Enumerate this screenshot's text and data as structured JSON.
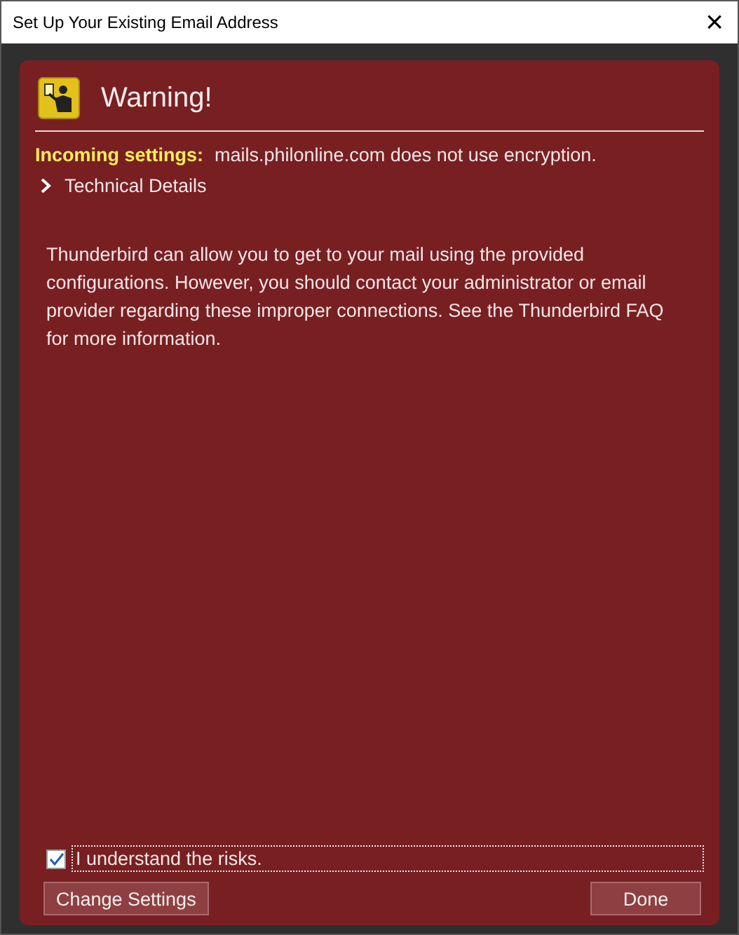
{
  "window": {
    "title": "Set Up Your Existing Email Address",
    "close": "×"
  },
  "warning": {
    "title": "Warning!",
    "settings": [
      {
        "label": "Incoming settings:",
        "message": "mails.philonline.com does not use encryption."
      }
    ],
    "details": {
      "label": "Technical Details",
      "expanded": false
    },
    "body": "Thunderbird can allow you to get to your mail using the provided configurations. However, you should contact your administrator or email provider regarding these improper connections. See the Thunderbird FAQ for more information.",
    "acknowledge": {
      "label": "I understand the risks.",
      "checked": true
    }
  },
  "buttons": [
    {
      "label": "Change Settings"
    },
    {
      "label": "Done"
    }
  ]
}
